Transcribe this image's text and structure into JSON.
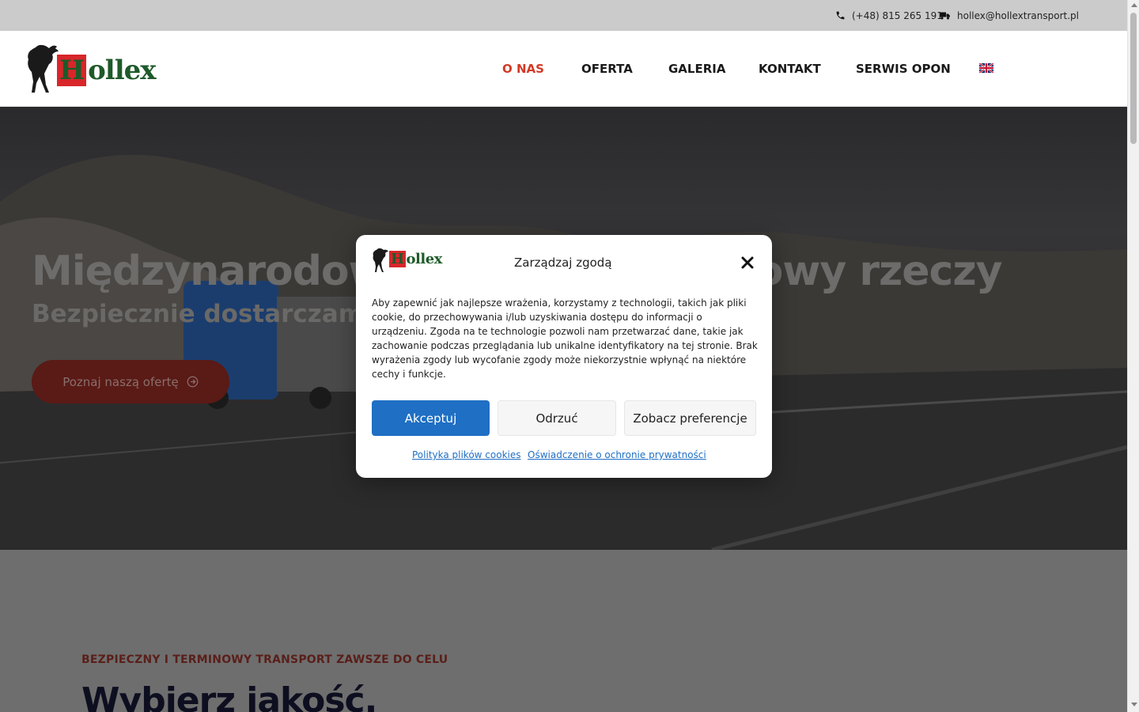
{
  "topbar": {
    "phone": "(+48) 815 265 191",
    "email": "hollex@hollextransport.pl",
    "phone_icon": "phone-icon",
    "email_icon": "truck-icon"
  },
  "header": {
    "logo_text_rest": "ollex",
    "logo_text_h": "H",
    "nav": [
      "O NAS",
      "OFERTA",
      "GALERIA",
      "KONTAKT",
      "SERWIS OPON"
    ],
    "active_nav": "O NAS",
    "language_icon": "uk-flag-icon"
  },
  "hero": {
    "title": "Międzynarodowy transport drogowy rzeczy",
    "subtitle": "Bezpiecznie dostarczamy",
    "cta_label": "Poznaj naszą ofertę"
  },
  "section": {
    "eyebrow": "BEZPIECZNY I TERMINOWY TRANSPORT ZAWSZE DO CELU",
    "title": "Wybierz jakość."
  },
  "consent": {
    "title": "Zarządzaj zgodą",
    "body": "Aby zapewnić jak najlepsze wrażenia, korzystamy z technologii, takich jak pliki cookie, do przechowywania i/lub uzyskiwania dostępu do informacji o urządzeniu. Zgoda na te technologie pozwoli nam przetwarzać dane, takie jak zachowanie podczas przeglądania lub unikalne identyfikatory na tej stronie. Brak wyrażenia zgody lub wycofanie zgody może niekorzystnie wpłynąć na niektóre cechy i funkcje.",
    "accept_label": "Akceptuj",
    "deny_label": "Odrzuć",
    "prefs_label": "Zobacz preferencje",
    "cookie_policy_link": "Polityka plików cookies",
    "privacy_link": "Oświadczenie o ochronie prywatności"
  },
  "colors": {
    "accent_red": "#d23a26",
    "accept_blue": "#1f6fc4",
    "logo_green": "#1e5a2a"
  }
}
